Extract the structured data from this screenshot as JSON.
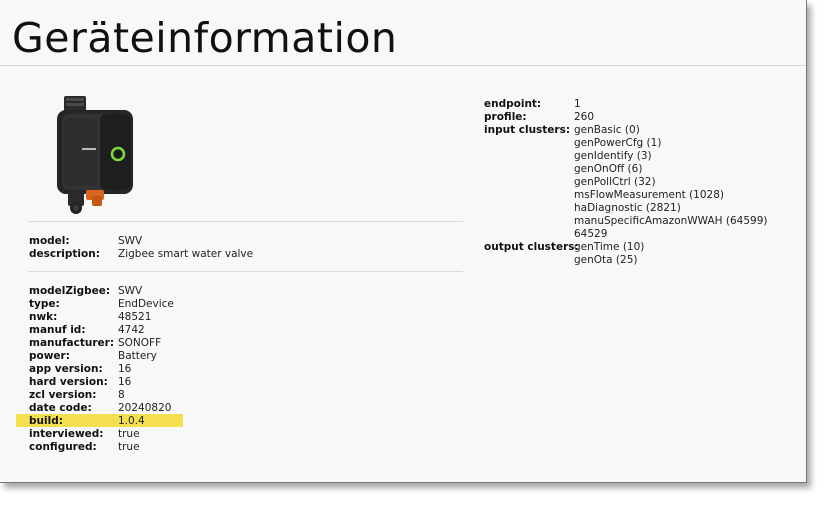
{
  "page": {
    "title": "Geräteinformation"
  },
  "summary": [
    {
      "key": "model:",
      "value": "SWV",
      "link": true
    },
    {
      "key": "description:",
      "value": "Zigbee smart water valve",
      "link": false
    }
  ],
  "details": [
    {
      "key": "modelZigbee:",
      "value": "SWV"
    },
    {
      "key": "type:",
      "value": "EndDevice"
    },
    {
      "key": "nwk:",
      "value": "48521"
    },
    {
      "key": "manuf id:",
      "value": "4742"
    },
    {
      "key": "manufacturer:",
      "value": "SONOFF"
    },
    {
      "key": "power:",
      "value": "Battery"
    },
    {
      "key": "app version:",
      "value": "16"
    },
    {
      "key": "hard version:",
      "value": "16"
    },
    {
      "key": "zcl version:",
      "value": "8"
    },
    {
      "key": "date code:",
      "value": "20240820"
    },
    {
      "key": "build:",
      "value": "1.0.4",
      "highlighted": true
    },
    {
      "key": "interviewed:",
      "value": "true"
    },
    {
      "key": "configured:",
      "value": "true"
    }
  ],
  "endpoint": [
    {
      "key": "endpoint:",
      "value": "1"
    },
    {
      "key": "profile:",
      "value": "260"
    },
    {
      "key": "input clusters:",
      "value": "genBasic (0)"
    },
    {
      "key": "",
      "value": "genPowerCfg (1)"
    },
    {
      "key": "",
      "value": "genIdentify (3)"
    },
    {
      "key": "",
      "value": "genOnOff (6)"
    },
    {
      "key": "",
      "value": "genPollCtrl (32)"
    },
    {
      "key": "",
      "value": "msFlowMeasurement (1028)"
    },
    {
      "key": "",
      "value": "haDiagnostic (2821)"
    },
    {
      "key": "",
      "value": "manuSpecificAmazonWWAH (64599)"
    },
    {
      "key": "",
      "value": "64529"
    },
    {
      "key": "output clusters:",
      "value": "genTime (10)"
    },
    {
      "key": "",
      "value": "genOta (25)"
    }
  ],
  "colors": {
    "link": "#2b7bd1",
    "highlight": "#f4e04f",
    "led_ring": "#7ddc3a"
  },
  "icons": {
    "device": "water-valve-device-image"
  }
}
